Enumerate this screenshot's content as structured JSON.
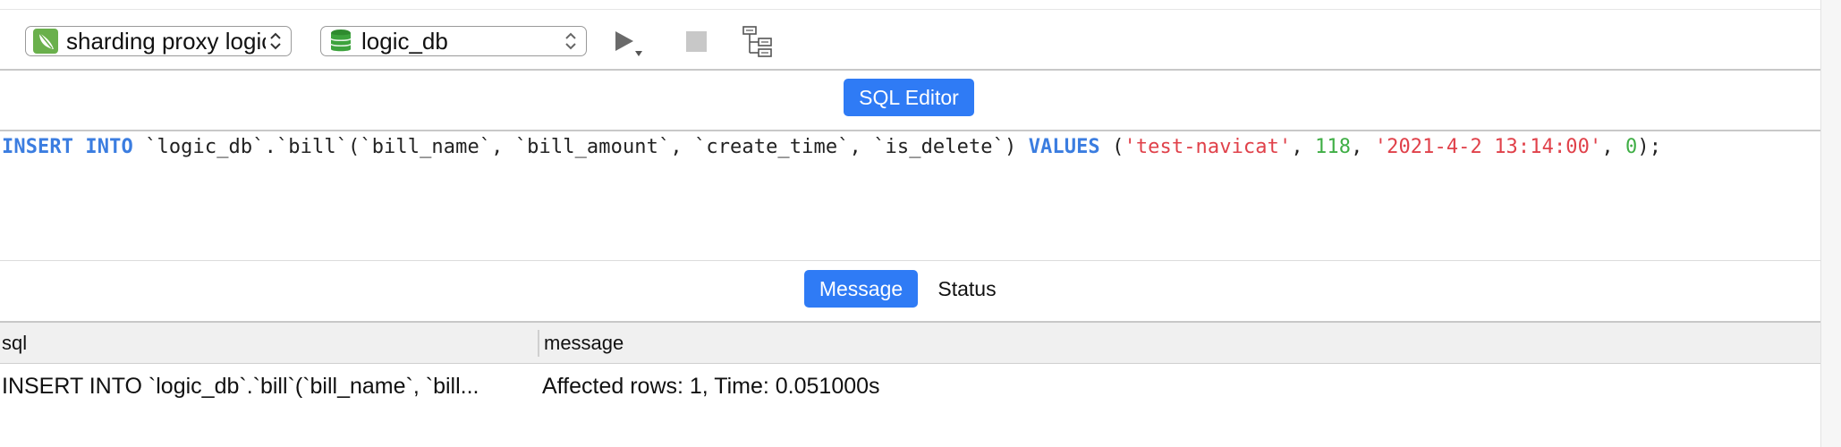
{
  "toolbar": {
    "connection": {
      "label": "sharding proxy logic",
      "icon": "connection-leaf-icon",
      "icon_color": "#6ab04c"
    },
    "database": {
      "label": "logic_db",
      "icon": "database-icon",
      "icon_color": "#2e8b2e"
    },
    "run_icon": "play-icon",
    "stop_icon": "stop-icon",
    "explain_icon": "explain-tree-icon"
  },
  "editor_tab": {
    "label": "SQL Editor"
  },
  "editor": {
    "tokens": [
      {
        "t": "INSERT INTO",
        "c": "kw"
      },
      {
        "t": " `logic_db`.`bill`(`bill_name`, `bill_amount`, `create_time`, `is_delete`) ",
        "c": ""
      },
      {
        "t": "VALUES",
        "c": "kw"
      },
      {
        "t": " (",
        "c": ""
      },
      {
        "t": "'test-navicat'",
        "c": "str"
      },
      {
        "t": ", ",
        "c": ""
      },
      {
        "t": "118",
        "c": "num"
      },
      {
        "t": ", ",
        "c": ""
      },
      {
        "t": "'2021-4-2 13:14:00'",
        "c": "str"
      },
      {
        "t": ", ",
        "c": ""
      },
      {
        "t": "0",
        "c": "num"
      },
      {
        "t": ");",
        "c": ""
      }
    ]
  },
  "result_tabs": {
    "message": "Message",
    "status": "Status"
  },
  "grid": {
    "columns": {
      "sql": "sql",
      "message": "message"
    },
    "rows": [
      {
        "sql": "INSERT INTO `logic_db`.`bill`(`bill_name`, `bill...",
        "message": "Affected rows: 1, Time: 0.051000s"
      }
    ]
  },
  "colors": {
    "accent": "#2f7bf5",
    "keyword": "#3b7de0",
    "string": "#e0414a",
    "number": "#3fae45"
  }
}
